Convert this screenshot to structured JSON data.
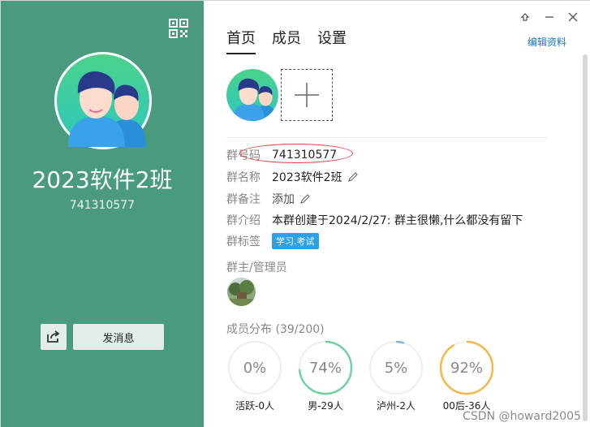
{
  "left_panel": {
    "group_name": "2023软件2班",
    "group_number": "741310577",
    "send_message_label": "发消息",
    "bg_color": "#4a9a80"
  },
  "tabs": [
    {
      "label": "首页",
      "active": true
    },
    {
      "label": "成员",
      "active": false
    },
    {
      "label": "设置",
      "active": false
    }
  ],
  "edit_profile_label": "编辑资料",
  "info": {
    "group_id_label": "群号码",
    "group_id_value": "741310577",
    "group_name_label": "群名称",
    "group_name_value": "2023软件2班",
    "remark_label": "群备注",
    "remark_value": "添加",
    "intro_label": "群介绍",
    "intro_value": "本群创建于2024/2/27:  群主很懒,什么都没有留下",
    "tag_label": "群标签",
    "tag_value": "学习.考试"
  },
  "owner_section_title": "群主/管理员",
  "distribution": {
    "title": "成员分布 (39/200)",
    "stats": [
      {
        "percent": "0%",
        "fraction": 0.0,
        "label": "活跃-0人",
        "color": "#cccccc"
      },
      {
        "percent": "74%",
        "fraction": 0.74,
        "label": "男-29人",
        "color": "#6fd0a0"
      },
      {
        "percent": "5%",
        "fraction": 0.05,
        "label": "泸州-2人",
        "color": "#7fb8e0"
      },
      {
        "percent": "92%",
        "fraction": 0.92,
        "label": "00后-36人",
        "color": "#f2b84b"
      }
    ]
  },
  "watermark": "CSDN @howard2005"
}
